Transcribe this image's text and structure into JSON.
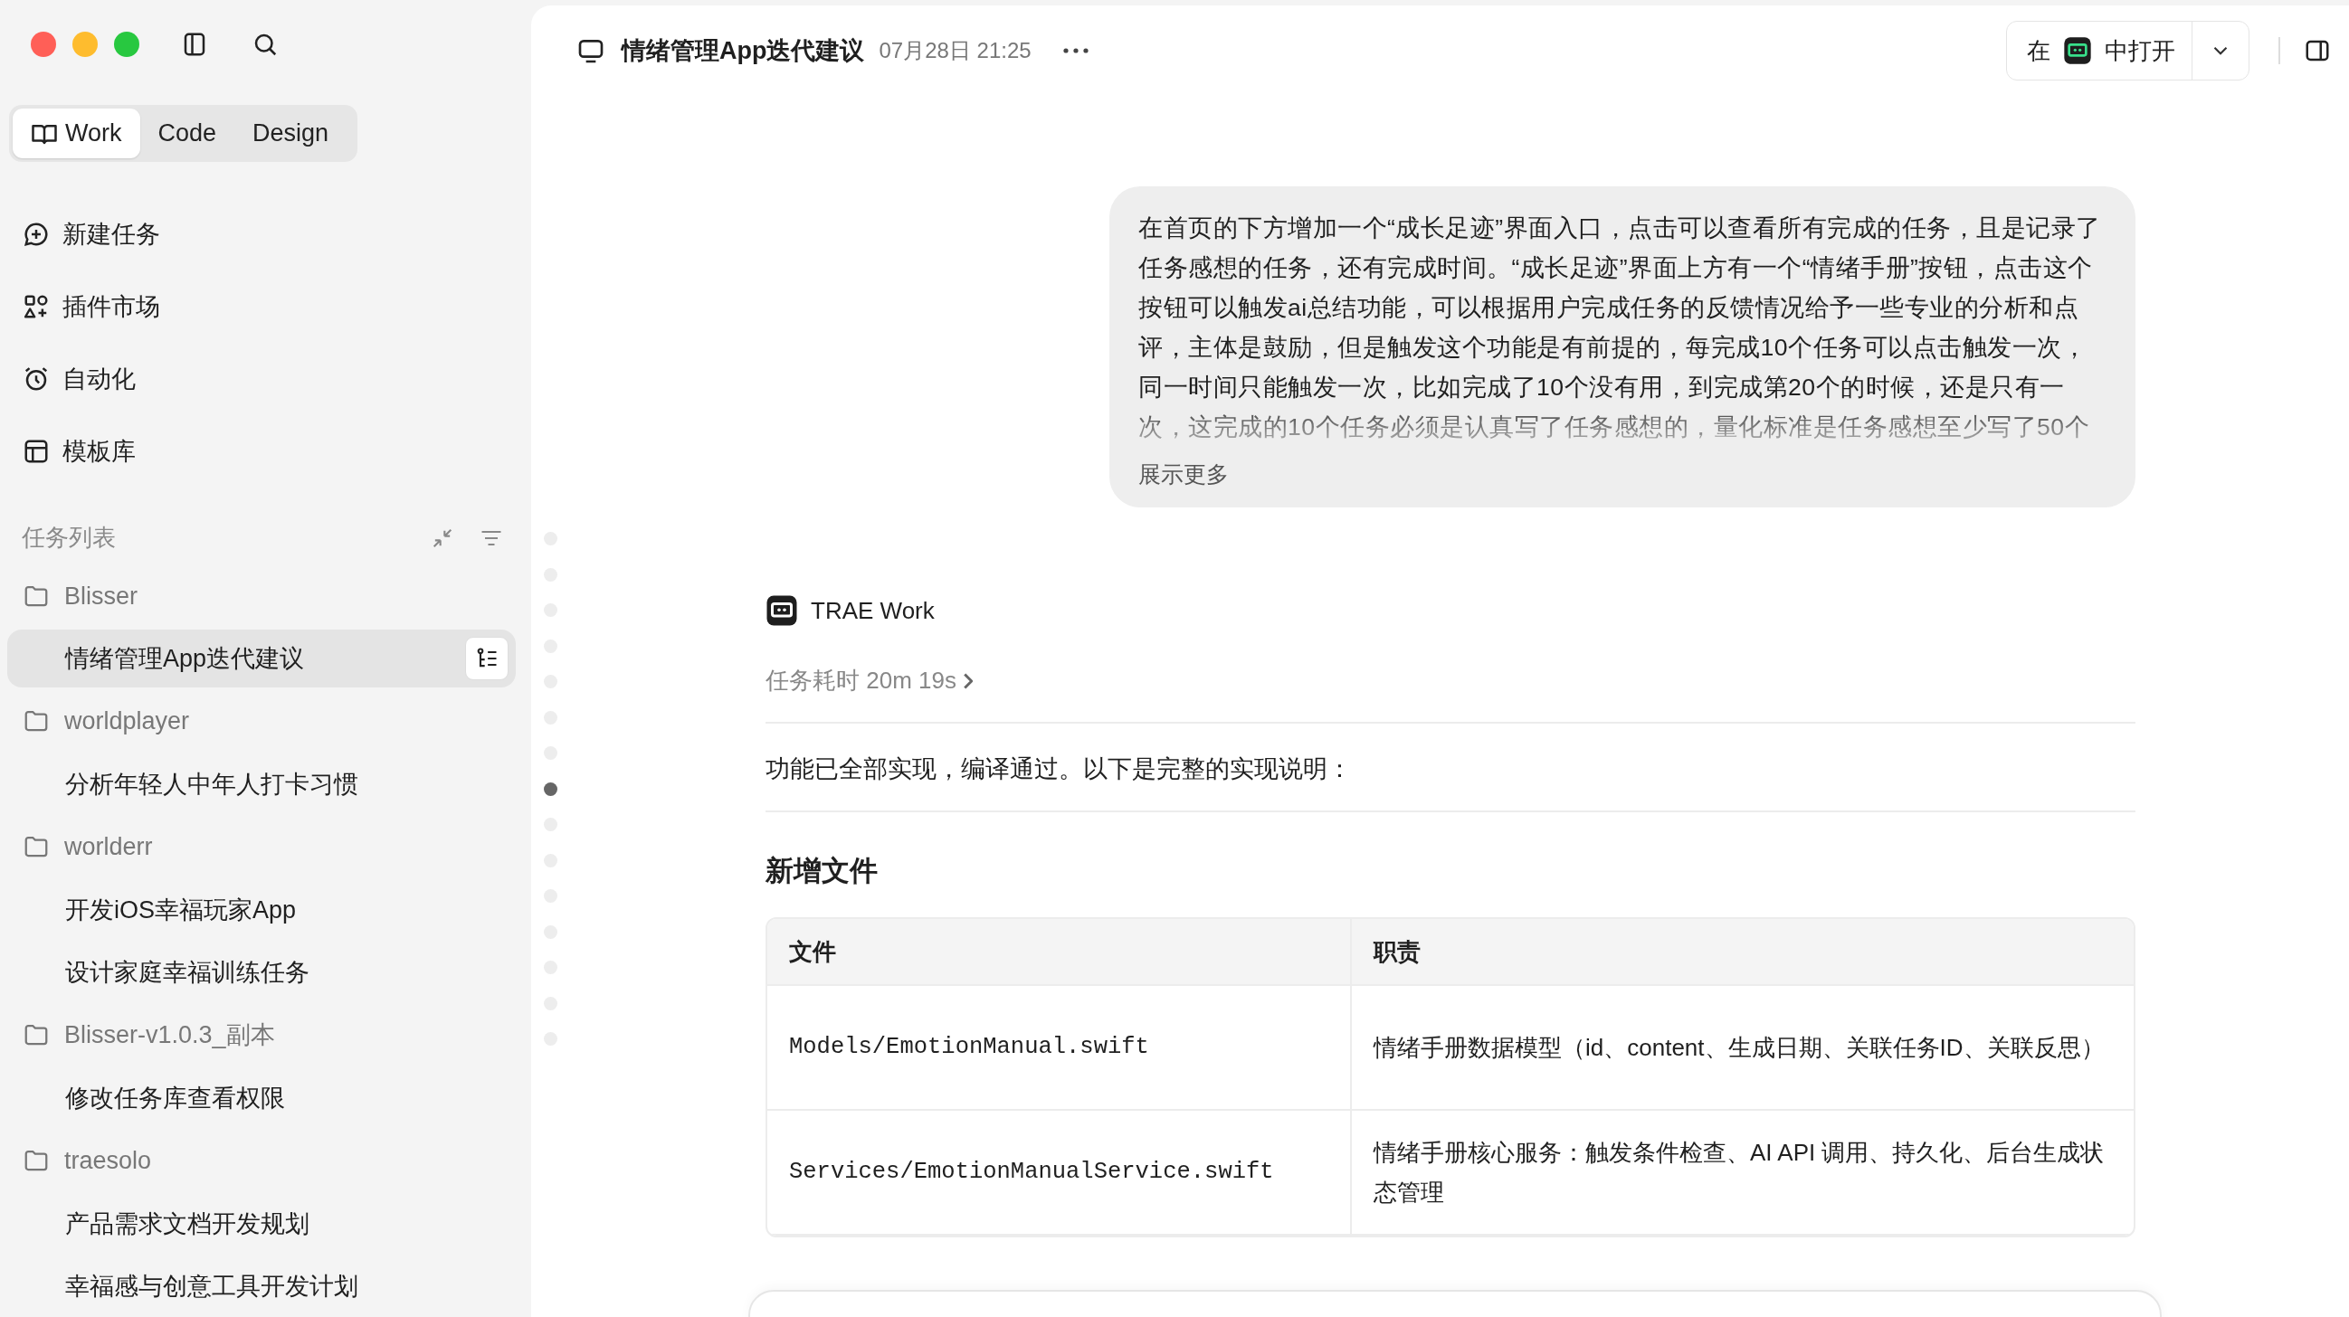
{
  "modes": [
    {
      "label": "Work",
      "selected": true
    },
    {
      "label": "Code",
      "selected": false
    },
    {
      "label": "Design",
      "selected": false
    }
  ],
  "nav": [
    {
      "kind": "new",
      "label": "新建任务"
    },
    {
      "kind": "plugins",
      "label": "插件市场"
    },
    {
      "kind": "alarm",
      "label": "自动化"
    },
    {
      "kind": "template",
      "label": "模板库"
    }
  ],
  "task_list": {
    "title": "任务列表",
    "groups": [
      {
        "name": "Blisser",
        "children": [
          {
            "label": "情绪管理App迭代建议",
            "selected": true
          }
        ]
      },
      {
        "name": "worldplayer",
        "children": [
          {
            "label": "分析年轻人中年人打卡习惯",
            "selected": false
          }
        ]
      },
      {
        "name": "worlderr",
        "children": [
          {
            "label": "开发iOS幸福玩家App",
            "selected": false
          },
          {
            "label": "设计家庭幸福训练任务",
            "selected": false
          }
        ]
      },
      {
        "name": "Blisser-v1.0.3_副本",
        "children": [
          {
            "label": "修改任务库查看权限",
            "selected": false
          }
        ]
      },
      {
        "name": "traesolo",
        "children": [
          {
            "label": "产品需求文档开发规划",
            "selected": false
          },
          {
            "label": "幸福感与创意工具开发计划",
            "selected": false
          }
        ]
      }
    ]
  },
  "header": {
    "title": "情绪管理App迭代建议",
    "time": "07月28日 21:25",
    "open_prefix": "在",
    "open_suffix": "中打开"
  },
  "timeline_dots": [
    {
      "selected": false
    },
    {
      "selected": false
    },
    {
      "selected": false
    },
    {
      "selected": false
    },
    {
      "selected": false
    },
    {
      "selected": false
    },
    {
      "selected": false
    },
    {
      "selected": true
    },
    {
      "selected": false
    },
    {
      "selected": false
    },
    {
      "selected": false
    },
    {
      "selected": false
    },
    {
      "selected": false
    },
    {
      "selected": false
    },
    {
      "selected": false
    }
  ],
  "message": {
    "text": "在首页的下方增加一个“成长足迹”界面入口，点击可以查看所有完成的任务，且是记录了任务感想的任务，还有完成时间。“成长足迹”界面上方有一个“情绪手册”按钮，点击这个按钮可以触发ai总结功能，可以根据用户完成任务的反馈情况给予一些专业的分析和点评，主体是鼓励，但是触发这个功能是有前提的，每完成10个任务可以点击触发一次，同一时间只能触发一次，比如完成了10个没有用，到完成第20个的时候，还是只有一次，这完成的10个任务必须是认真写了任务感想的，量化标准是任务感想至少写了50个",
    "more": "展示更多"
  },
  "reply": {
    "agent": "TRAE Work",
    "duration": "任务耗时 20m 19s",
    "summary": "功能已全部实现，编译通过。以下是完整的实现说明：",
    "section_title": "新增文件",
    "table": {
      "columns": [
        "文件",
        "职责"
      ],
      "rows": [
        [
          "Models/EmotionManual.swift",
          "情绪手册数据模型（id、content、生成日期、关联任务ID、关联反思）"
        ],
        [
          "Services/EmotionManualService.swift",
          "情绪手册核心服务：触发条件检查、AI API 调用、持久化、后台生成状态管理"
        ]
      ]
    }
  }
}
